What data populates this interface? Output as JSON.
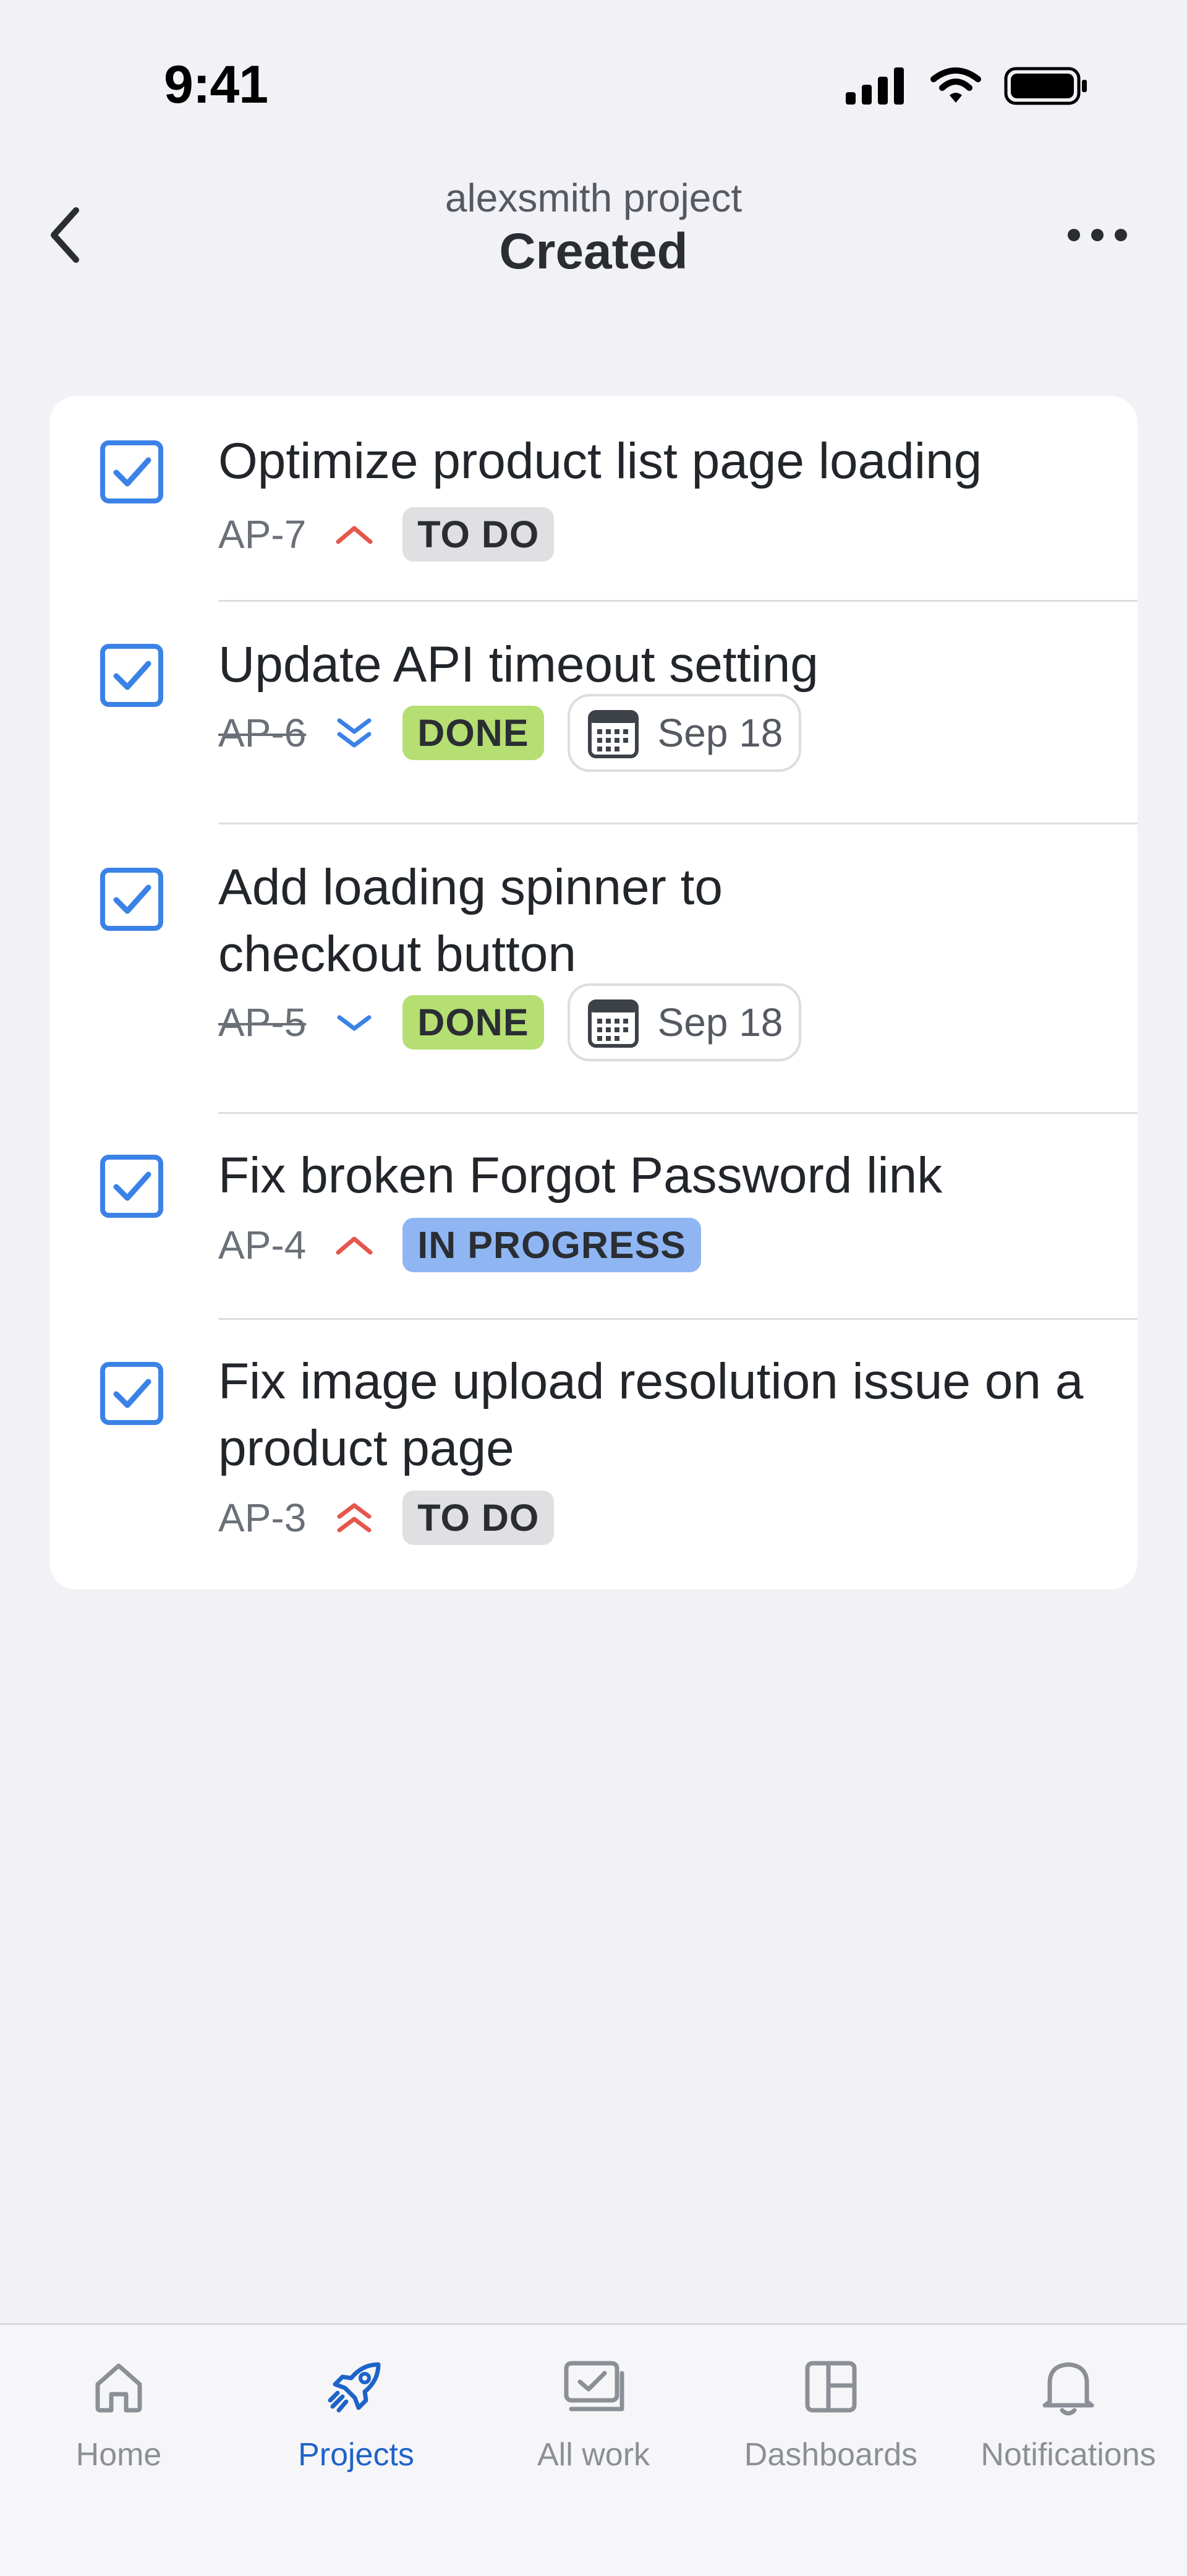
{
  "status_bar": {
    "time": "9:41"
  },
  "header": {
    "subtitle": "alexsmith project",
    "title": "Created"
  },
  "issues": [
    {
      "title": "Optimize product list page loading",
      "key": "AP-7",
      "priority": "medium",
      "status": "TO DO",
      "date": ""
    },
    {
      "title": "Update API timeout setting",
      "key": "AP-6",
      "priority": "lowest",
      "status": "DONE",
      "date": "Sep 18"
    },
    {
      "title": "Add loading spinner to checkout button",
      "key": "AP-5",
      "priority": "low",
      "status": "DONE",
      "date": "Sep 18"
    },
    {
      "title": "Fix broken Forgot Password link",
      "key": "AP-4",
      "priority": "medium",
      "status": "IN PROGRESS",
      "date": ""
    },
    {
      "title": "Fix image upload resolution issue on a product page",
      "key": "AP-3",
      "priority": "high",
      "status": "TO DO",
      "date": ""
    }
  ],
  "tabbar": {
    "items": [
      {
        "label": "Home",
        "icon": "home-icon",
        "active": false
      },
      {
        "label": "Projects",
        "icon": "rocket-icon",
        "active": true
      },
      {
        "label": "All work",
        "icon": "all-work-icon",
        "active": false
      },
      {
        "label": "Dashboards",
        "icon": "dashboard-icon",
        "active": false
      },
      {
        "label": "Notifications",
        "icon": "bell-icon",
        "active": false
      }
    ]
  },
  "colors": {
    "accent": "#1f63c9",
    "checkbox": "#3b82e6",
    "priority_high": "#e5564b",
    "priority_low": "#3b82e6",
    "todo": "#e0e0e2",
    "done": "#b5df72",
    "in_progress": "#8fb6f3"
  }
}
